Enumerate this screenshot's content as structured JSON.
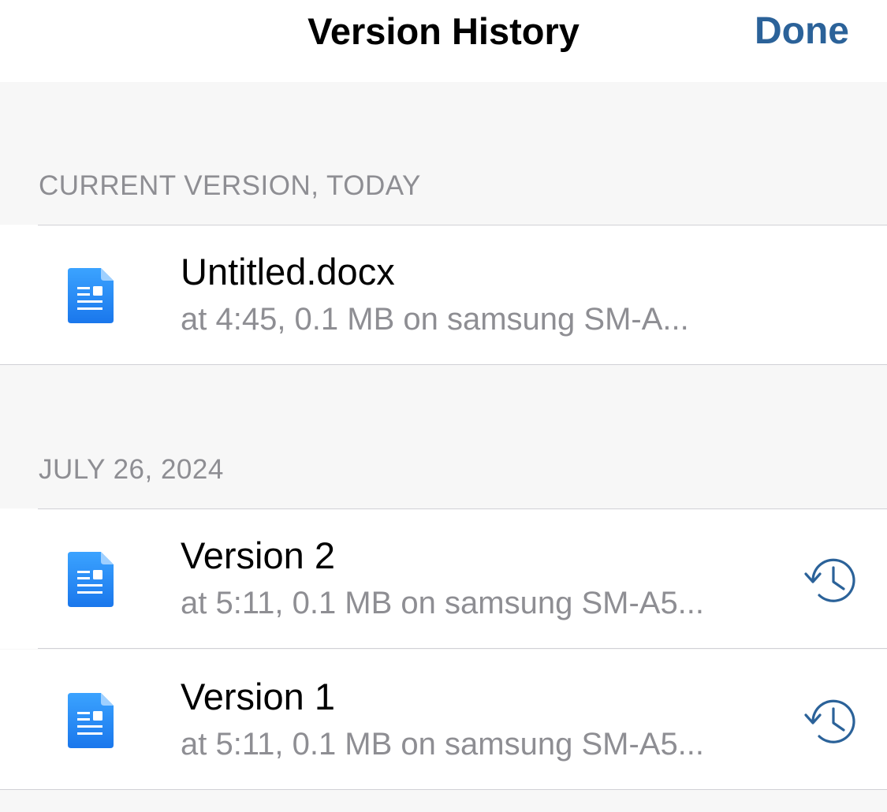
{
  "nav": {
    "title": "Version History",
    "done_label": "Done"
  },
  "sections": [
    {
      "header": "CURRENT VERSION, TODAY",
      "items": [
        {
          "title": "Untitled.docx",
          "subtitle": "at 4:45, 0.1 MB on samsung SM-A...",
          "icon": "document-icon",
          "restorable": false
        }
      ]
    },
    {
      "header": "JULY 26, 2024",
      "items": [
        {
          "title": "Version 2",
          "subtitle": "at 5:11, 0.1 MB on samsung SM-A5...",
          "icon": "document-icon",
          "restorable": true
        },
        {
          "title": "Version 1",
          "subtitle": "at 5:11, 0.1 MB on samsung SM-A5...",
          "icon": "document-icon",
          "restorable": true
        }
      ]
    }
  ],
  "colors": {
    "accent": "#2b6299",
    "doc_icon_top": "#3aa0ff",
    "doc_icon_bottom": "#1a73e8",
    "secondary_text": "#8e8e93",
    "grouped_background": "#f7f7f7"
  }
}
